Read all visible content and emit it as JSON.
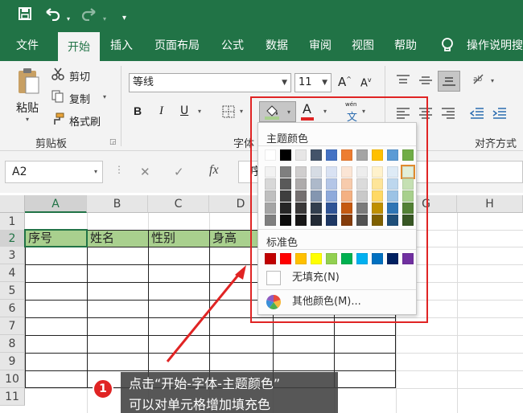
{
  "quick_access": {
    "icons": [
      "save-icon",
      "undo-icon",
      "redo-icon",
      "customize-icon"
    ]
  },
  "tabs": [
    "文件",
    "开始",
    "插入",
    "页面布局",
    "公式",
    "数据",
    "审阅",
    "视图",
    "帮助"
  ],
  "tell_me": "操作说明搜",
  "clipboard": {
    "paste": "粘贴",
    "cut": "剪切",
    "copy": "复制",
    "format_painter": "格式刷",
    "group": "剪贴板"
  },
  "font": {
    "name": "等线",
    "size": "11",
    "group": "字体",
    "bold": "B",
    "italic": "I",
    "underline": "U",
    "grow": "A",
    "shrink": "A",
    "font_color_letter": "A",
    "phonetic_top": "wén",
    "phonetic_bottom": "文"
  },
  "alignment": {
    "group": "对齐方式"
  },
  "formula_bar": {
    "name_box": "A2",
    "cancel": "✕",
    "enter": "✓",
    "fx": "fx",
    "content": "序"
  },
  "columns": [
    "A",
    "B",
    "C",
    "D",
    "E",
    "F",
    "G",
    "H"
  ],
  "rows": [
    "1",
    "2",
    "3",
    "4",
    "5",
    "6",
    "7",
    "8",
    "9",
    "10",
    "11"
  ],
  "header_row": [
    "序号",
    "姓名",
    "性别",
    "身高"
  ],
  "header_fill": "#a9d08e",
  "color_menu": {
    "theme_title": "主题颜色",
    "standard_title": "标准色",
    "no_fill": "无填充(N)",
    "more_colors": "其他颜色(M)...",
    "theme_top": [
      "#ffffff",
      "#000000",
      "#e7e6e6",
      "#44546a",
      "#4472c4",
      "#ed7d31",
      "#a5a5a5",
      "#ffc000",
      "#5b9bd5",
      "#70ad47"
    ],
    "theme_shades": [
      [
        "#f2f2f2",
        "#7f7f7f",
        "#d0cece",
        "#d6dce4",
        "#d9e2f3",
        "#fbe5d5",
        "#ededed",
        "#fff2cc",
        "#deebf6",
        "#e2efd9"
      ],
      [
        "#d8d8d8",
        "#595959",
        "#aeabab",
        "#adb9ca",
        "#b4c6e7",
        "#f7cbac",
        "#dbdbdb",
        "#fee599",
        "#bdd7ee",
        "#c5e0b3"
      ],
      [
        "#bfbfbf",
        "#3f3f3f",
        "#757070",
        "#8496b0",
        "#8eaadb",
        "#f4b183",
        "#c9c9c9",
        "#ffd965",
        "#9cc3e5",
        "#a8d08d"
      ],
      [
        "#a5a5a5",
        "#262626",
        "#3a3838",
        "#323f4f",
        "#2f5496",
        "#c55a11",
        "#7b7b7b",
        "#bf9000",
        "#2e75b5",
        "#538135"
      ],
      [
        "#7f7f7f",
        "#0c0c0c",
        "#171616",
        "#222a35",
        "#1e3864",
        "#843c0b",
        "#525252",
        "#7f6000",
        "#1e4e79",
        "#375623"
      ]
    ],
    "standard": [
      "#c00000",
      "#ff0000",
      "#ffc000",
      "#ffff00",
      "#92d050",
      "#00b050",
      "#00b0f0",
      "#0070c0",
      "#002060",
      "#7030a0"
    ]
  },
  "annotation": {
    "step": "1",
    "line1": "点击“开始-字体-主题颜色”",
    "line2": "可以对单元格增加填充色"
  },
  "colors": {
    "brand": "#217346",
    "highlight": "#e02424"
  }
}
